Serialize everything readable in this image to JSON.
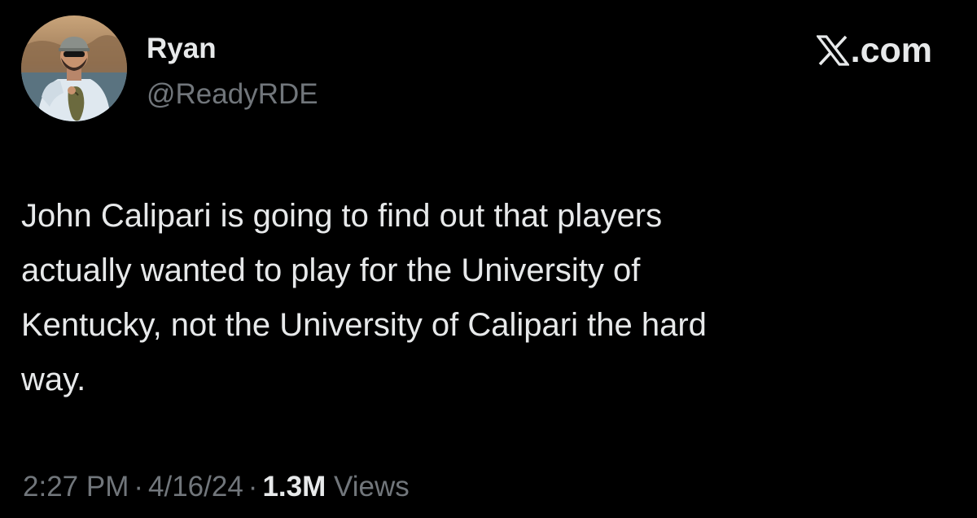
{
  "author": {
    "display_name": "Ryan",
    "handle": "@ReadyRDE",
    "avatar_icon": "fisherman-holding-bass-photo"
  },
  "source": {
    "label": ".com",
    "logo_icon": "x-logo-icon"
  },
  "tweet": {
    "lines": [
      "John Calipari is going to find out that players",
      "actually wanted to play for the University of",
      "Kentucky, not the University of Calipari the hard",
      "way."
    ]
  },
  "meta": {
    "time": "2:27 PM",
    "separator": "·",
    "date": "4/16/24",
    "views_count": "1.3M",
    "views_label": "Views"
  },
  "colors": {
    "background": "#000000",
    "primary_text": "#e7e9ea",
    "secondary_text": "#71767b"
  }
}
